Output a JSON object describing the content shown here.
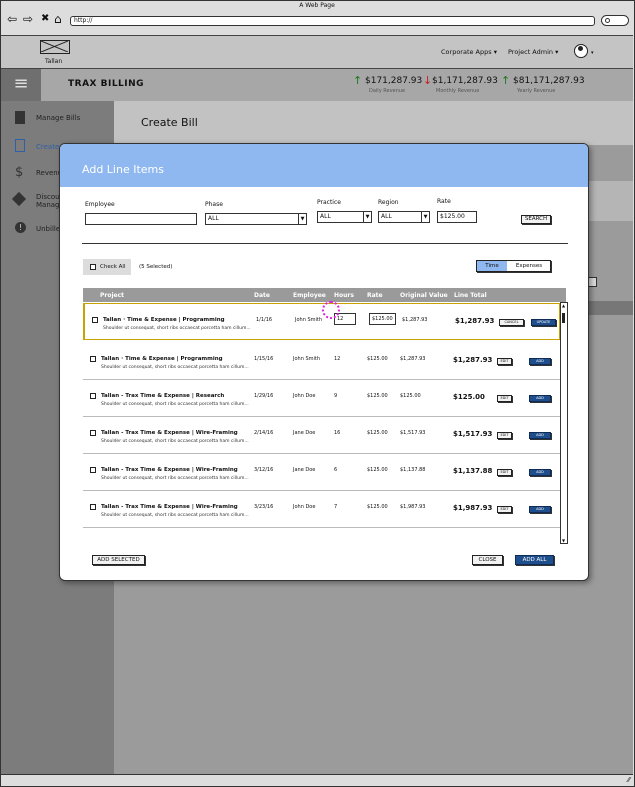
{
  "browser": {
    "title": "A Web Page",
    "url": "http://"
  },
  "header": {
    "logo_text": "Tallan",
    "menu1": "Corporate Apps ▾",
    "menu2": "Project Admin ▾",
    "avatar_caret": "▾"
  },
  "trax": {
    "title": "TRAX BILLING",
    "stats": [
      {
        "value": "$171,287.93",
        "label": "Daily Revenue",
        "arrow": "↑",
        "color": "#1a7a1a"
      },
      {
        "value": "$1,171,287.93",
        "label": "Monthly Revenue",
        "arrow": "↓",
        "color": "#c81e1e"
      },
      {
        "value": "$81,171,287.93",
        "label": "Yearly Revenue",
        "arrow": "↑",
        "color": "#1a7a1a"
      }
    ]
  },
  "sidebar": {
    "items": [
      {
        "label": "Manage Bills",
        "icon": "document-icon"
      },
      {
        "label": "Create",
        "icon": "new-document-icon"
      },
      {
        "label": "Revenu",
        "icon": "dollar-icon"
      },
      {
        "label": "Discou",
        "label2": "Manag",
        "icon": "tag-icon"
      },
      {
        "label": "Unbille",
        "icon": "alert-icon"
      }
    ]
  },
  "page": {
    "title": "Create Bill"
  },
  "modal": {
    "title": "Add Line Items",
    "filters": {
      "employee_label": "Employee",
      "employee_value": "",
      "phase_label": "Phase",
      "phase_value": "ALL",
      "practice_label": "Practice",
      "practice_value": "ALL",
      "region_label": "Region",
      "region_value": "ALL",
      "rate_label": "Rate",
      "rate_value": "$125.00",
      "search_label": "SEARCH"
    },
    "check_all": "Check All",
    "selected_count": "(5 Selected)",
    "toggle": {
      "time": "Time",
      "expenses": "Expenses"
    },
    "columns": [
      "Project",
      "Date",
      "Employee",
      "Hours",
      "Rate",
      "Original Value",
      "Line Total"
    ],
    "rows": [
      {
        "project": "Tallan  · Time & Expense  | Programming",
        "desc": "Shoulder ut consequat, short ribs occaecat porcetta ham cillum...",
        "date": "1/1/16",
        "employee": "John Smith",
        "hours": "12",
        "rate": "$125.00",
        "original": "$1,287.93",
        "total": "$1,287.93",
        "btn1": "CANCEL",
        "btn2": "UPDATE",
        "editing": true
      },
      {
        "project": "Tallan  · Time & Expense  | Programming",
        "desc": "Shoulder ut consequat, short ribs occaecat porcetta ham cillum...",
        "date": "1/15/16",
        "employee": "John Smith",
        "hours": "12",
        "rate": "$125.00",
        "original": "$1,287.93",
        "total": "$1,287.93",
        "btn1": "EDIT",
        "btn2": "ADD",
        "editing": false
      },
      {
        "project": "Tallan  - Trax Time & Expense  | Research",
        "desc": "Shoulder ut consequat, short ribs occaecat porcetta ham cillum...",
        "date": "1/29/16",
        "employee": "John Doe",
        "hours": "9",
        "rate": "$125.00",
        "original": "$125.00",
        "total": "$125.00",
        "btn1": "EDIT",
        "btn2": "ADD",
        "editing": false
      },
      {
        "project": "Tallan  - Trax Time & Expense | Wire-Framing",
        "desc": "Shoulder ut consequat, short ribs occaecat porcetta ham cillum...",
        "date": "2/14/16",
        "employee": "Jane Doe",
        "hours": "16",
        "rate": "$125.00",
        "original": "$1,517.93",
        "total": "$1,517.93",
        "btn1": "EDIT",
        "btn2": "ADD",
        "editing": false
      },
      {
        "project": "Tallan  - Trax Time & Expense  | Wire-Framing",
        "desc": "Shoulder ut consequat, short ribs occaecat porcetta ham cillum...",
        "date": "3/12/16",
        "employee": "Jane Doe",
        "hours": "6",
        "rate": "$125.00",
        "original": "$1,137.88",
        "total": "$1,137.88",
        "btn1": "EDIT",
        "btn2": "ADD",
        "editing": false
      },
      {
        "project": "Tallan  - Trax Time & Expense | Wire-Framing",
        "desc": "Shoulder ut consequat, short ribs occaecat porcetta ham cillum...",
        "date": "3/23/16",
        "employee": "John Doe",
        "hours": "7",
        "rate": "$125.00",
        "original": "$1,987.93",
        "total": "$1,987.93",
        "btn1": "EDIT",
        "btn2": "ADD",
        "editing": false
      }
    ],
    "add_selected": "ADD SELECTED",
    "close": "CLOSE",
    "add_all": "ADD ALL"
  }
}
